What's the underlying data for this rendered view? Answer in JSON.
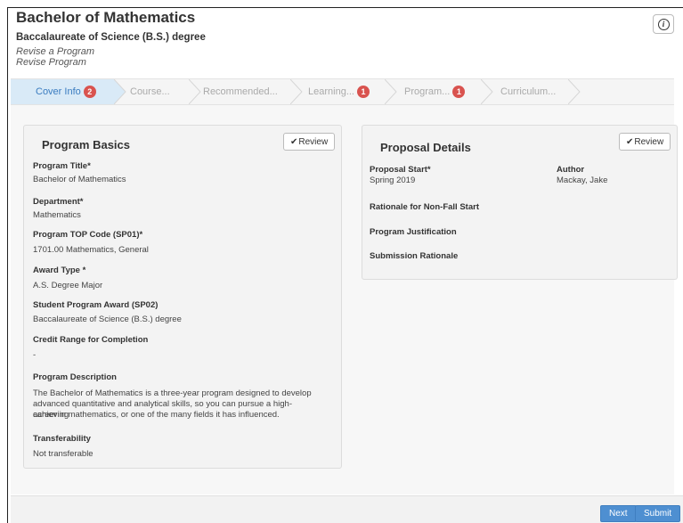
{
  "header": {
    "title": "Bachelor of Mathematics",
    "subtitle": "Baccalaureate of Science (B.S.) degree",
    "action_1": "Revise a Program",
    "action_2": "Revise Program",
    "info_icon": "info-icon"
  },
  "steps": [
    {
      "label": "Cover Info",
      "badge": "2",
      "active": true
    },
    {
      "label": "Course...",
      "badge": "",
      "active": false
    },
    {
      "label": "Recommended...",
      "badge": "",
      "active": false
    },
    {
      "label": "Learning...",
      "badge": "1",
      "active": false
    },
    {
      "label": "Program...",
      "badge": "1",
      "active": false
    },
    {
      "label": "Curriculum...",
      "badge": "",
      "active": false
    }
  ],
  "program_basics": {
    "title": "Program Basics",
    "review_label": "Review",
    "fields": {
      "program_title_label": "Program Title*",
      "program_title_value": "Bachelor of Mathematics",
      "department_label": "Department*",
      "department_value": "Mathematics",
      "top_code_label": "Program TOP Code (SP01)*",
      "top_code_value": "1701.00 Mathematics, General",
      "award_type_label": "Award Type *",
      "award_type_value": "A.S. Degree Major",
      "student_award_label": "Student Program Award (SP02)",
      "student_award_value": "Baccalaureate of Science (B.S.) degree",
      "credit_range_label": "Credit Range for Completion",
      "credit_range_value": "-",
      "description_label": "Program Description",
      "description_line_1": "The Bachelor of Mathematics is a three-year program designed to develop",
      "description_line_2": "advanced quantitative and analytical skills, so you can pursue a high-achieving",
      "description_line_3": "career in mathematics, or one of the many fields it has influenced.",
      "transferability_label": "Transferability",
      "transferability_value": "Not transferable"
    }
  },
  "proposal_details": {
    "title": "Proposal Details",
    "review_label": "Review",
    "proposal_start_label": "Proposal Start*",
    "proposal_start_value": "Spring 2019",
    "author_label": "Author",
    "author_value": "Mackay, Jake",
    "rationale_label": "Rationale for Non-Fall Start",
    "justification_label": "Program Justification",
    "submission_label": "Submission Rationale"
  },
  "footer": {
    "next_label": "Next",
    "submit_label": "Submit"
  },
  "colors": {
    "primary": "#4e8fd1",
    "badge": "#d9534f",
    "active_step_bg": "#d9eaf7"
  }
}
